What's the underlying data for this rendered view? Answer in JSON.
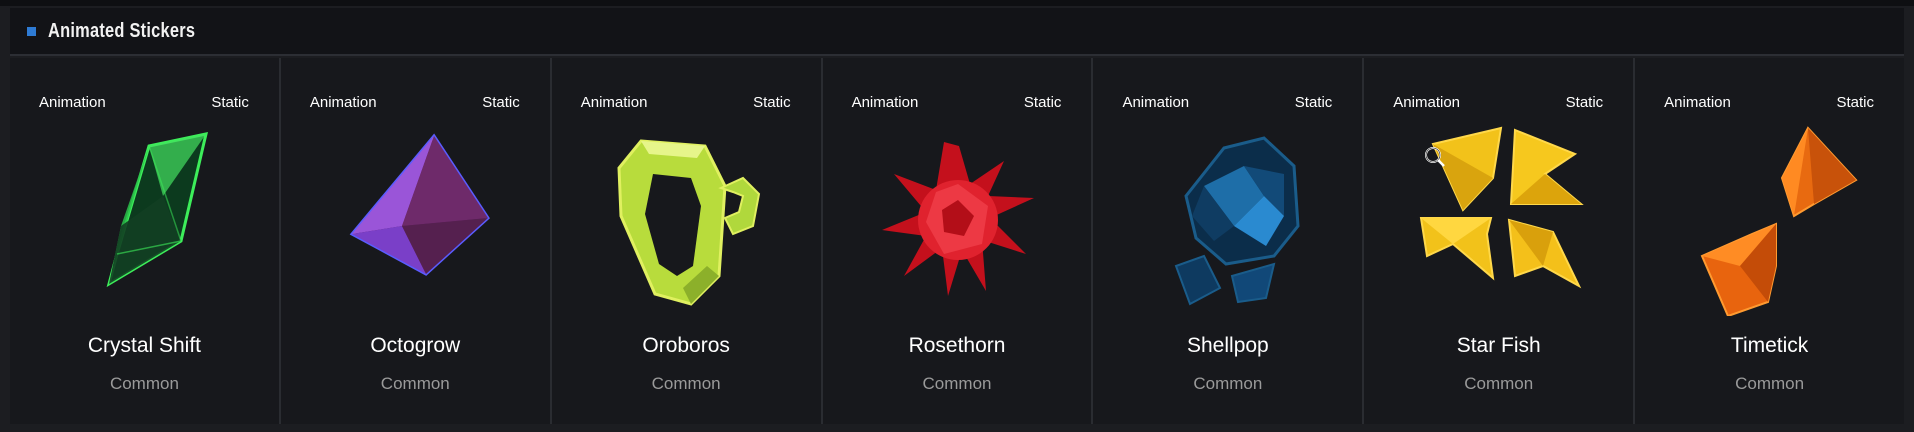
{
  "section": {
    "title": "Animated Stickers",
    "bullet_icon": "square-bullet-icon",
    "accent_color": "#2e7bd4"
  },
  "stickers": [
    {
      "name": "Crystal Shift",
      "rarity": "Common",
      "animation_label": "Animation",
      "static_label": "Static",
      "icon": "green-crystal-icon",
      "color": "#2fd64a"
    },
    {
      "name": "Octogrow",
      "rarity": "Common",
      "animation_label": "Animation",
      "static_label": "Static",
      "icon": "purple-octahedron-icon",
      "color": "#8a4ed0"
    },
    {
      "name": "Oroboros",
      "rarity": "Common",
      "animation_label": "Animation",
      "static_label": "Static",
      "icon": "yellow-green-ring-icon",
      "color": "#c8e84a"
    },
    {
      "name": "Rosethorn",
      "rarity": "Common",
      "animation_label": "Animation",
      "static_label": "Static",
      "icon": "red-spiky-ball-icon",
      "color": "#e0202e"
    },
    {
      "name": "Shellpop",
      "rarity": "Common",
      "animation_label": "Animation",
      "static_label": "Static",
      "icon": "blue-shell-icon",
      "color": "#1e6ea8"
    },
    {
      "name": "Star Fish",
      "rarity": "Common",
      "animation_label": "Animation",
      "static_label": "Static",
      "icon": "gold-star-shards-icon",
      "color": "#f2c21a"
    },
    {
      "name": "Timetick",
      "rarity": "Common",
      "animation_label": "Animation",
      "static_label": "Static",
      "icon": "orange-hourglass-icon",
      "color": "#f07a14"
    }
  ]
}
